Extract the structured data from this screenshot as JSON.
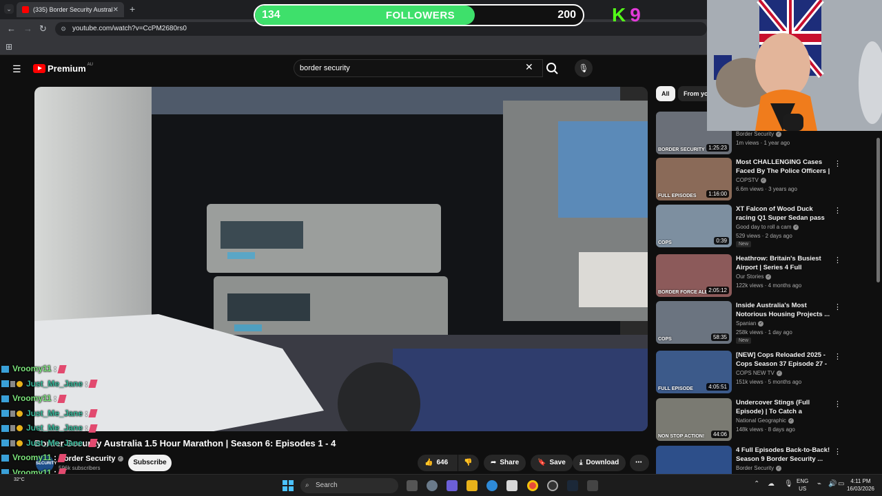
{
  "browser": {
    "tab_title": "(335) Border Security Australia",
    "url": "youtube.com/watch?v=CcPM2680rs0"
  },
  "followers_goal": {
    "current": "134",
    "label": "FOLLOWERS",
    "target": "200",
    "progress_fraction": 0.67
  },
  "kick_badge": {
    "letter": "K",
    "number": "9"
  },
  "youtube": {
    "logo_text": "Premium",
    "region": "AU",
    "search_value": "border security"
  },
  "video": {
    "title": "Border Security Australia 1.5 Hour Marathon | Season 6: Episodes 1 - 4",
    "channel": "Border Security",
    "subscribers": "596k subscribers",
    "subscribe_label": "Subscribe",
    "likes": "646",
    "share_label": "Share",
    "save_label": "Save",
    "download_label": "Download"
  },
  "chips": [
    "All",
    "From yo"
  ],
  "recommendations": [
    {
      "title": "",
      "channel": "Border Security",
      "meta": "1m views · 1 year ago",
      "duration": "1:25:23",
      "badge": "",
      "thumb_color": "#6a6f78"
    },
    {
      "title": "Most CHALLENGING Cases Faced By The Police Officers | ...",
      "channel": "COPSTV",
      "meta": "6.6m views · 3 years ago",
      "duration": "1:16:00",
      "badge": "",
      "thumb_color": "#8a6a58"
    },
    {
      "title": "XT Falcon of Wood Duck racing Q1 Super Sedan pass round 2 ...",
      "channel": "Good day to roll a cam",
      "meta": "529 views · 2 days ago",
      "duration": "0:39",
      "badge": "New",
      "thumb_color": "#7d8fa0"
    },
    {
      "title": "Heathrow: Britain's Busiest Airport | Series 4 Full Maratho...",
      "channel": "Our Stories",
      "meta": "122k views · 4 months ago",
      "duration": "2:05:12",
      "badge": "",
      "thumb_color": "#8c5a5a"
    },
    {
      "title": "Inside Australia's Most Notorious Housing Projects ...",
      "channel": "Spanian",
      "meta": "258k views · 1 day ago",
      "duration": "58:35",
      "badge": "New",
      "thumb_color": "#6b7480"
    },
    {
      "title": "[NEW] Cops Reloaded 2025 - Cops Season 37 Episode 27 - ...",
      "channel": "COPS NEW TV",
      "meta": "151k views · 5 months ago",
      "duration": "4:05:51",
      "badge": "",
      "thumb_color": "#3c5a8a"
    },
    {
      "title": "Undercover Stings (Full Episode) | To Catch a Smuggler",
      "channel": "National Geographic",
      "meta": "148k views · 8 days ago",
      "duration": "44:06",
      "badge": "",
      "thumb_color": "#7a7a72"
    },
    {
      "title": "4 Full Episodes Back-to-Back! Season 9 Border Security ...",
      "channel": "Border Security",
      "meta": "",
      "duration": "",
      "badge": "",
      "thumb_color": "#2d4f8a"
    }
  ],
  "thumb_labels": [
    "BORDER SECURITY",
    "FULL EPISODES",
    "COPS",
    "BORDER FORCE ALERT",
    "COPS",
    "FULL EPISODE",
    "NON STOP ACTION!"
  ],
  "chat": [
    {
      "user": "Vroomy11",
      "color": "#7be37b",
      "badges": "tw"
    },
    {
      "user": "Just_Me_Jane",
      "color": "#39b89a",
      "badges": "full"
    },
    {
      "user": "Vroomy11",
      "color": "#7be37b",
      "badges": "tw"
    },
    {
      "user": "Just_Me_Jane",
      "color": "#39b89a",
      "badges": "full"
    },
    {
      "user": "Just_Me_Jane",
      "color": "#39b89a",
      "badges": "full"
    },
    {
      "user": "Just_Me_Jane",
      "color": "#39b89a",
      "badges": "full"
    },
    {
      "user": "Vroomy11",
      "color": "#7be37b",
      "badges": "tw"
    },
    {
      "user": "Vroomy11",
      "color": "#7be37b",
      "badges": "tw"
    },
    {
      "user": "Vroomy11",
      "color": "#7be37b",
      "badges": "tw"
    }
  ],
  "taskbar": {
    "search_label": "Search",
    "weather": "32°C",
    "lang": "ENG",
    "region": "US",
    "time": "4:11 PM",
    "date": "16/03/2026"
  }
}
